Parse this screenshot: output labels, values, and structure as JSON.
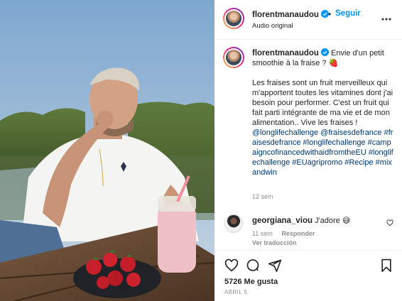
{
  "header": {
    "username": "florentmanaudou",
    "separator": "•",
    "follow_label": "Seguir",
    "subtitle": "Audio original"
  },
  "caption": {
    "username": "florentmanaudou",
    "first_line": "Envie d'un petit smoothie à la fraise ? 🍓",
    "body": "Les fraises sont un fruit merveilleux qui m'apportent toutes les vitamines dont j'ai besoin pour performer. C'est un fruit qui fait parti intégrante de ma vie et de mon alimentation.. Vive les fraises !",
    "hashtags": "@longlifechallenge @fraisesdefrance #fraisesdefrance #longlifechallenge #campaigncofinancedwithaidfromtheEU #longlifechallenge #EUagripromo #Recipe #mixandwin",
    "time": "12 sem"
  },
  "comment": {
    "username": "georgiana_viou",
    "text": "J'adore 😅",
    "time": "11 sem",
    "reply_label": "Responder",
    "translate_label": "Ver traducción"
  },
  "post": {
    "likes": "5726 Me gusta",
    "date": "ABRIL 5"
  },
  "icons": {
    "verified": "verified-badge-icon",
    "more": "more-options-icon",
    "like": "heart-icon",
    "comment": "comment-icon",
    "share": "share-icon",
    "save": "bookmark-icon"
  },
  "colors": {
    "link": "#0095f6",
    "hashtag": "#00376b",
    "muted": "#8e8e8e",
    "verified": "#0095f6"
  }
}
